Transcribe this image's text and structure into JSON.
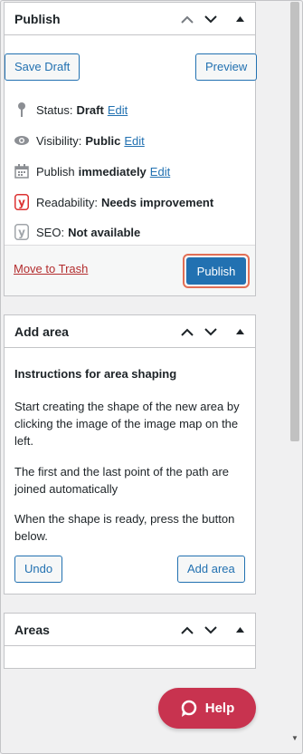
{
  "publish_box": {
    "title": "Publish",
    "save_draft_label": "Save Draft",
    "preview_label": "Preview",
    "status_label": "Status:",
    "status_value": "Draft",
    "status_edit": "Edit",
    "visibility_label": "Visibility:",
    "visibility_value": "Public",
    "visibility_edit": "Edit",
    "publish_label": "Publish",
    "publish_value": "immediately",
    "publish_edit": "Edit",
    "readability_label": "Readability:",
    "readability_value": "Needs improvement",
    "seo_label": "SEO:",
    "seo_value": "Not available",
    "move_to_trash": "Move to Trash",
    "publish_button": "Publish"
  },
  "add_area_box": {
    "title": "Add area",
    "heading": "Instructions for area shaping",
    "para1": "Start creating the shape of the new area by clicking the image of the image map on the left.",
    "para2": "The first and the last point of the path are joined automatically",
    "para3": "When the shape is ready, press the button below.",
    "undo_label": "Undo",
    "add_area_label": "Add area"
  },
  "areas_box": {
    "title": "Areas"
  },
  "help_button": {
    "label": "Help"
  },
  "colors": {
    "accent": "#2271b1",
    "trash": "#b32d2e",
    "help_bg": "#c8334f",
    "highlight": "#e26f56"
  }
}
